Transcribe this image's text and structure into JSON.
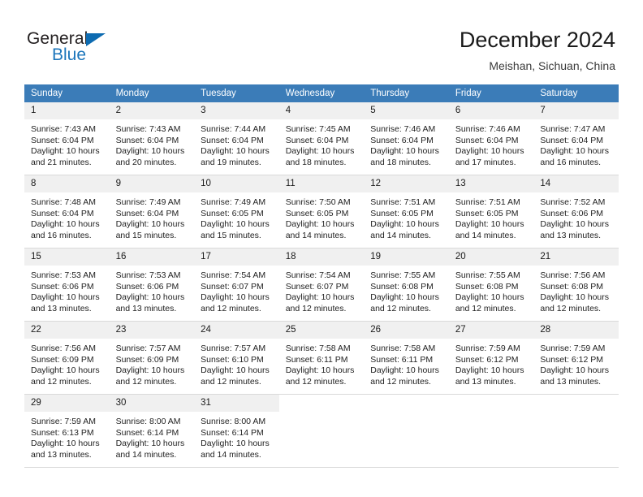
{
  "brand": {
    "name_top": "General",
    "name_bottom": "Blue",
    "color_dark": "#231f20",
    "color_blue": "#1b75bb"
  },
  "header": {
    "title": "December 2024",
    "subtitle": "Meishan, Sichuan, China",
    "accent_color": "#3b7cb8"
  },
  "calendar": {
    "weekday_headers": [
      "Sunday",
      "Monday",
      "Tuesday",
      "Wednesday",
      "Thursday",
      "Friday",
      "Saturday"
    ],
    "labels": {
      "sunrise": "Sunrise:",
      "sunset": "Sunset:",
      "daylight": "Daylight:"
    },
    "weeks": [
      [
        {
          "day": "1",
          "sunrise": "Sunrise: 7:43 AM",
          "sunset": "Sunset: 6:04 PM",
          "daylight_line1": "Daylight: 10 hours",
          "daylight_line2": "and 21 minutes."
        },
        {
          "day": "2",
          "sunrise": "Sunrise: 7:43 AM",
          "sunset": "Sunset: 6:04 PM",
          "daylight_line1": "Daylight: 10 hours",
          "daylight_line2": "and 20 minutes."
        },
        {
          "day": "3",
          "sunrise": "Sunrise: 7:44 AM",
          "sunset": "Sunset: 6:04 PM",
          "daylight_line1": "Daylight: 10 hours",
          "daylight_line2": "and 19 minutes."
        },
        {
          "day": "4",
          "sunrise": "Sunrise: 7:45 AM",
          "sunset": "Sunset: 6:04 PM",
          "daylight_line1": "Daylight: 10 hours",
          "daylight_line2": "and 18 minutes."
        },
        {
          "day": "5",
          "sunrise": "Sunrise: 7:46 AM",
          "sunset": "Sunset: 6:04 PM",
          "daylight_line1": "Daylight: 10 hours",
          "daylight_line2": "and 18 minutes."
        },
        {
          "day": "6",
          "sunrise": "Sunrise: 7:46 AM",
          "sunset": "Sunset: 6:04 PM",
          "daylight_line1": "Daylight: 10 hours",
          "daylight_line2": "and 17 minutes."
        },
        {
          "day": "7",
          "sunrise": "Sunrise: 7:47 AM",
          "sunset": "Sunset: 6:04 PM",
          "daylight_line1": "Daylight: 10 hours",
          "daylight_line2": "and 16 minutes."
        }
      ],
      [
        {
          "day": "8",
          "sunrise": "Sunrise: 7:48 AM",
          "sunset": "Sunset: 6:04 PM",
          "daylight_line1": "Daylight: 10 hours",
          "daylight_line2": "and 16 minutes."
        },
        {
          "day": "9",
          "sunrise": "Sunrise: 7:49 AM",
          "sunset": "Sunset: 6:04 PM",
          "daylight_line1": "Daylight: 10 hours",
          "daylight_line2": "and 15 minutes."
        },
        {
          "day": "10",
          "sunrise": "Sunrise: 7:49 AM",
          "sunset": "Sunset: 6:05 PM",
          "daylight_line1": "Daylight: 10 hours",
          "daylight_line2": "and 15 minutes."
        },
        {
          "day": "11",
          "sunrise": "Sunrise: 7:50 AM",
          "sunset": "Sunset: 6:05 PM",
          "daylight_line1": "Daylight: 10 hours",
          "daylight_line2": "and 14 minutes."
        },
        {
          "day": "12",
          "sunrise": "Sunrise: 7:51 AM",
          "sunset": "Sunset: 6:05 PM",
          "daylight_line1": "Daylight: 10 hours",
          "daylight_line2": "and 14 minutes."
        },
        {
          "day": "13",
          "sunrise": "Sunrise: 7:51 AM",
          "sunset": "Sunset: 6:05 PM",
          "daylight_line1": "Daylight: 10 hours",
          "daylight_line2": "and 14 minutes."
        },
        {
          "day": "14",
          "sunrise": "Sunrise: 7:52 AM",
          "sunset": "Sunset: 6:06 PM",
          "daylight_line1": "Daylight: 10 hours",
          "daylight_line2": "and 13 minutes."
        }
      ],
      [
        {
          "day": "15",
          "sunrise": "Sunrise: 7:53 AM",
          "sunset": "Sunset: 6:06 PM",
          "daylight_line1": "Daylight: 10 hours",
          "daylight_line2": "and 13 minutes."
        },
        {
          "day": "16",
          "sunrise": "Sunrise: 7:53 AM",
          "sunset": "Sunset: 6:06 PM",
          "daylight_line1": "Daylight: 10 hours",
          "daylight_line2": "and 13 minutes."
        },
        {
          "day": "17",
          "sunrise": "Sunrise: 7:54 AM",
          "sunset": "Sunset: 6:07 PM",
          "daylight_line1": "Daylight: 10 hours",
          "daylight_line2": "and 12 minutes."
        },
        {
          "day": "18",
          "sunrise": "Sunrise: 7:54 AM",
          "sunset": "Sunset: 6:07 PM",
          "daylight_line1": "Daylight: 10 hours",
          "daylight_line2": "and 12 minutes."
        },
        {
          "day": "19",
          "sunrise": "Sunrise: 7:55 AM",
          "sunset": "Sunset: 6:08 PM",
          "daylight_line1": "Daylight: 10 hours",
          "daylight_line2": "and 12 minutes."
        },
        {
          "day": "20",
          "sunrise": "Sunrise: 7:55 AM",
          "sunset": "Sunset: 6:08 PM",
          "daylight_line1": "Daylight: 10 hours",
          "daylight_line2": "and 12 minutes."
        },
        {
          "day": "21",
          "sunrise": "Sunrise: 7:56 AM",
          "sunset": "Sunset: 6:08 PM",
          "daylight_line1": "Daylight: 10 hours",
          "daylight_line2": "and 12 minutes."
        }
      ],
      [
        {
          "day": "22",
          "sunrise": "Sunrise: 7:56 AM",
          "sunset": "Sunset: 6:09 PM",
          "daylight_line1": "Daylight: 10 hours",
          "daylight_line2": "and 12 minutes."
        },
        {
          "day": "23",
          "sunrise": "Sunrise: 7:57 AM",
          "sunset": "Sunset: 6:09 PM",
          "daylight_line1": "Daylight: 10 hours",
          "daylight_line2": "and 12 minutes."
        },
        {
          "day": "24",
          "sunrise": "Sunrise: 7:57 AM",
          "sunset": "Sunset: 6:10 PM",
          "daylight_line1": "Daylight: 10 hours",
          "daylight_line2": "and 12 minutes."
        },
        {
          "day": "25",
          "sunrise": "Sunrise: 7:58 AM",
          "sunset": "Sunset: 6:11 PM",
          "daylight_line1": "Daylight: 10 hours",
          "daylight_line2": "and 12 minutes."
        },
        {
          "day": "26",
          "sunrise": "Sunrise: 7:58 AM",
          "sunset": "Sunset: 6:11 PM",
          "daylight_line1": "Daylight: 10 hours",
          "daylight_line2": "and 12 minutes."
        },
        {
          "day": "27",
          "sunrise": "Sunrise: 7:59 AM",
          "sunset": "Sunset: 6:12 PM",
          "daylight_line1": "Daylight: 10 hours",
          "daylight_line2": "and 13 minutes."
        },
        {
          "day": "28",
          "sunrise": "Sunrise: 7:59 AM",
          "sunset": "Sunset: 6:12 PM",
          "daylight_line1": "Daylight: 10 hours",
          "daylight_line2": "and 13 minutes."
        }
      ],
      [
        {
          "day": "29",
          "sunrise": "Sunrise: 7:59 AM",
          "sunset": "Sunset: 6:13 PM",
          "daylight_line1": "Daylight: 10 hours",
          "daylight_line2": "and 13 minutes."
        },
        {
          "day": "30",
          "sunrise": "Sunrise: 8:00 AM",
          "sunset": "Sunset: 6:14 PM",
          "daylight_line1": "Daylight: 10 hours",
          "daylight_line2": "and 14 minutes."
        },
        {
          "day": "31",
          "sunrise": "Sunrise: 8:00 AM",
          "sunset": "Sunset: 6:14 PM",
          "daylight_line1": "Daylight: 10 hours",
          "daylight_line2": "and 14 minutes."
        },
        {
          "day": "",
          "sunrise": "",
          "sunset": "",
          "daylight_line1": "",
          "daylight_line2": ""
        },
        {
          "day": "",
          "sunrise": "",
          "sunset": "",
          "daylight_line1": "",
          "daylight_line2": ""
        },
        {
          "day": "",
          "sunrise": "",
          "sunset": "",
          "daylight_line1": "",
          "daylight_line2": ""
        },
        {
          "day": "",
          "sunrise": "",
          "sunset": "",
          "daylight_line1": "",
          "daylight_line2": ""
        }
      ]
    ]
  }
}
